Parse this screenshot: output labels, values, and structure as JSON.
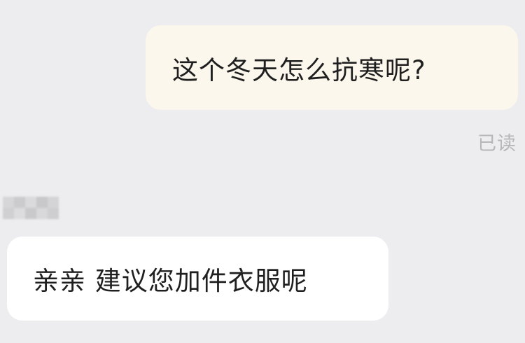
{
  "conversation": {
    "outgoing_message": {
      "text": "这个冬天怎么抗寒呢?",
      "status": "已读"
    },
    "incoming_message": {
      "sender_name": "",
      "text": "亲亲 建议您加件衣服呢"
    }
  },
  "colors": {
    "background": "#ededef",
    "outgoing_bubble": "#fcf7ec",
    "incoming_bubble": "#ffffff",
    "message_text": "#1f1f1f",
    "status_text": "#b6b6b8"
  }
}
